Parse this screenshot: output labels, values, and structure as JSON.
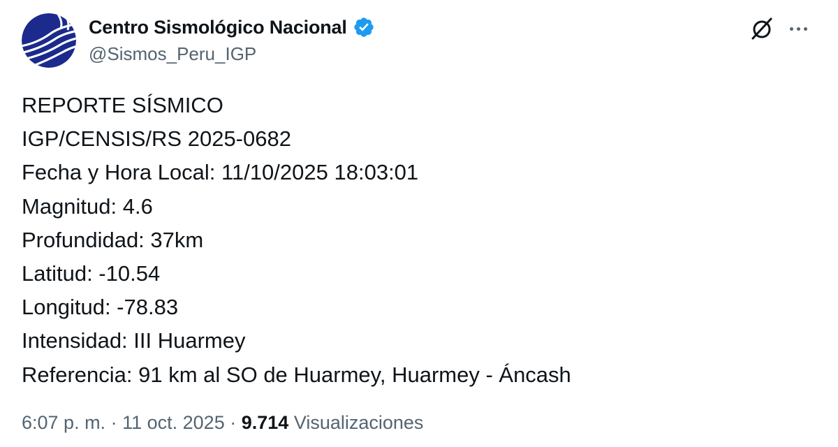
{
  "account": {
    "display_name": "Centro Sismológico Nacional",
    "handle": "@Sismos_Peru_IGP",
    "verified": true,
    "avatar_icon": "igp-logo-icon",
    "verified_icon": "verified-badge-icon"
  },
  "actions": {
    "grok_icon": "grok-icon",
    "more_icon": "more-icon"
  },
  "tweet": {
    "lines": [
      "REPORTE SÍSMICO",
      "IGP/CENSIS/RS 2025-0682",
      "Fecha y Hora Local: 11/10/2025 18:03:01",
      "Magnitud: 4.6",
      "Profundidad: 37km",
      "Latitud: -10.54",
      "Longitud: -78.83",
      "Intensidad: III Huarmey",
      "Referencia: 91 km al SO de Huarmey, Huarmey - Áncash"
    ]
  },
  "meta": {
    "time": "6:07 p. m.",
    "separator": "·",
    "date": "11 oct. 2025",
    "views_count": "9.714",
    "views_label": "Visualizaciones"
  },
  "colors": {
    "text_primary": "#0f1419",
    "text_secondary": "#536471",
    "verified_blue": "#1d9bf0",
    "avatar_navy": "#1b2a8c"
  }
}
